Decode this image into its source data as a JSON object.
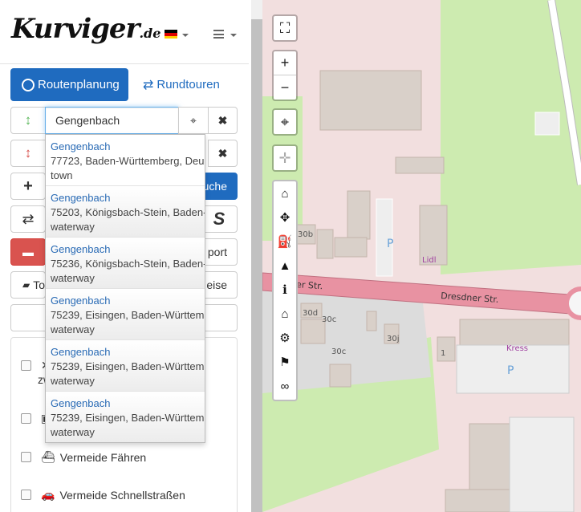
{
  "brand": {
    "logo": "Kurviger",
    "tld": ".de"
  },
  "header": {
    "language": "de"
  },
  "tabs": [
    {
      "label": "Routenplanung",
      "icon": "compass-icon"
    },
    {
      "label": "Rundtouren",
      "icon": "roundtrip-icon"
    }
  ],
  "waypoints": [
    {
      "value": "Gengenbach",
      "handle_icon": "arrows-vertical-icon",
      "handle_color": "#5cb85c"
    },
    {
      "value": "",
      "handle_icon": "arrows-vertical-icon",
      "handle_color": "#d9534f"
    }
  ],
  "autocomplete": [
    {
      "name": "Gengenbach",
      "desc": "77723, Baden-Württemberg, Deu",
      "type": "town"
    },
    {
      "name": "Gengenbach",
      "desc": "75203, Königsbach-Stein, Baden-",
      "type": "waterway"
    },
    {
      "name": "Gengenbach",
      "desc": "75236, Königsbach-Stein, Baden-",
      "type": "waterway"
    },
    {
      "name": "Gengenbach",
      "desc": "75239, Eisingen, Baden-Württem",
      "type": "waterway"
    },
    {
      "name": "Gengenbach",
      "desc": "75239, Eisingen, Baden-Württem",
      "type": "waterway"
    },
    {
      "name": "Gengenbach",
      "desc": "75239, Eisingen, Baden-Württem",
      "type": "waterway"
    }
  ],
  "buttons": {
    "add": "+",
    "search_partial": "uche",
    "swap": "⇄",
    "curvy": "S",
    "delete": "🗑",
    "export_partial": "port",
    "tour_partial": "To",
    "hints_partial": "eise"
  },
  "options": [
    {
      "label": "zw",
      "icon": "motorway-icon"
    },
    {
      "label": "",
      "icon": "toll-icon"
    },
    {
      "label": "Vermeide Fähren",
      "icon": "ferry-icon"
    },
    {
      "label": "Vermeide Schnellstraßen",
      "icon": "car-icon"
    }
  ],
  "map": {
    "labels": {
      "street1": "Dresdner Str.",
      "street2": "dner Str.",
      "lidl": "Lidl",
      "kress": "Kress",
      "parking": "P",
      "h30b": "30b",
      "h30d": "30d",
      "h30c_a": "30c",
      "h30c_b": "30c",
      "h30j": "30j",
      "h1": "1"
    },
    "zoom_in": "+",
    "zoom_out": "−"
  },
  "colors": {
    "accent": "#1f6bbf",
    "danger": "#d9534f",
    "map_bg": "#f2dfdf",
    "grass": "#cdebb0",
    "road": "#e892a2"
  }
}
